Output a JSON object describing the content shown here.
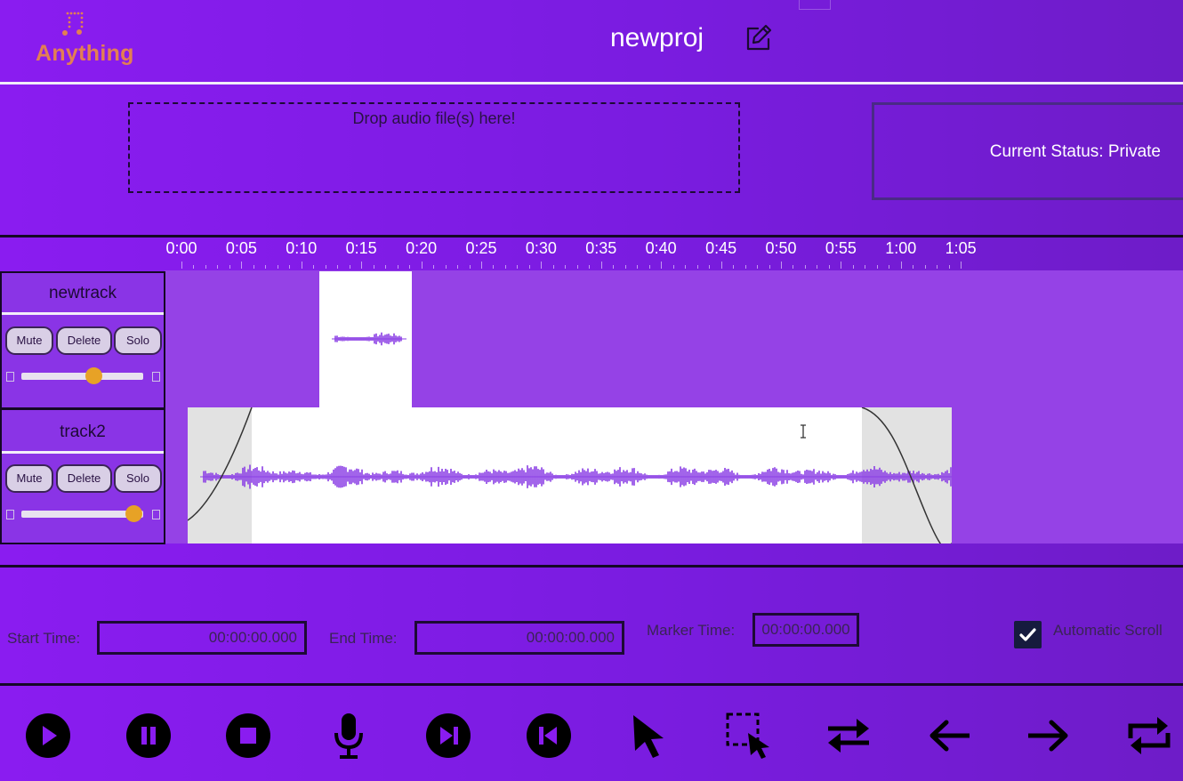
{
  "app": {
    "logo_text": "Anything"
  },
  "header": {
    "project_name": "newproj"
  },
  "upload": {
    "drop_text": "Drop audio file(s) here!"
  },
  "status": {
    "text": "Current Status: Private"
  },
  "timeline": {
    "ticks": [
      "0:00",
      "0:05",
      "0:10",
      "0:15",
      "0:20",
      "0:25",
      "0:30",
      "0:35",
      "0:40",
      "0:45",
      "0:50",
      "0:55",
      "1:00",
      "1:05"
    ]
  },
  "tracks": [
    {
      "name": "newtrack",
      "mute": "Mute",
      "delete": "Delete",
      "solo": "Solo",
      "volume": 0.59
    },
    {
      "name": "track2",
      "mute": "Mute",
      "delete": "Delete",
      "solo": "Solo",
      "volume": 0.92
    }
  ],
  "fields": {
    "start_label": "Start Time:",
    "start_value": "00:00:00.000",
    "end_label": "End Time:",
    "end_value": "00:00:00.000",
    "marker_label": "Marker Time:",
    "marker_value": "00:00:00.000",
    "autoscroll_label": "Automatic Scroll",
    "autoscroll_checked": true
  },
  "toolbar": [
    "play-icon",
    "pause-icon",
    "stop-icon",
    "microphone-icon",
    "skip-forward-icon",
    "skip-back-icon",
    "pointer-icon",
    "select-region-icon",
    "shift-icon",
    "arrow-left-icon",
    "arrow-right-icon",
    "loop-icon"
  ],
  "colors": {
    "accent": "#8a1cf0",
    "waveform": "#8a3ee4",
    "slider_knob": "#e7a226",
    "logo": "#e37f52"
  }
}
